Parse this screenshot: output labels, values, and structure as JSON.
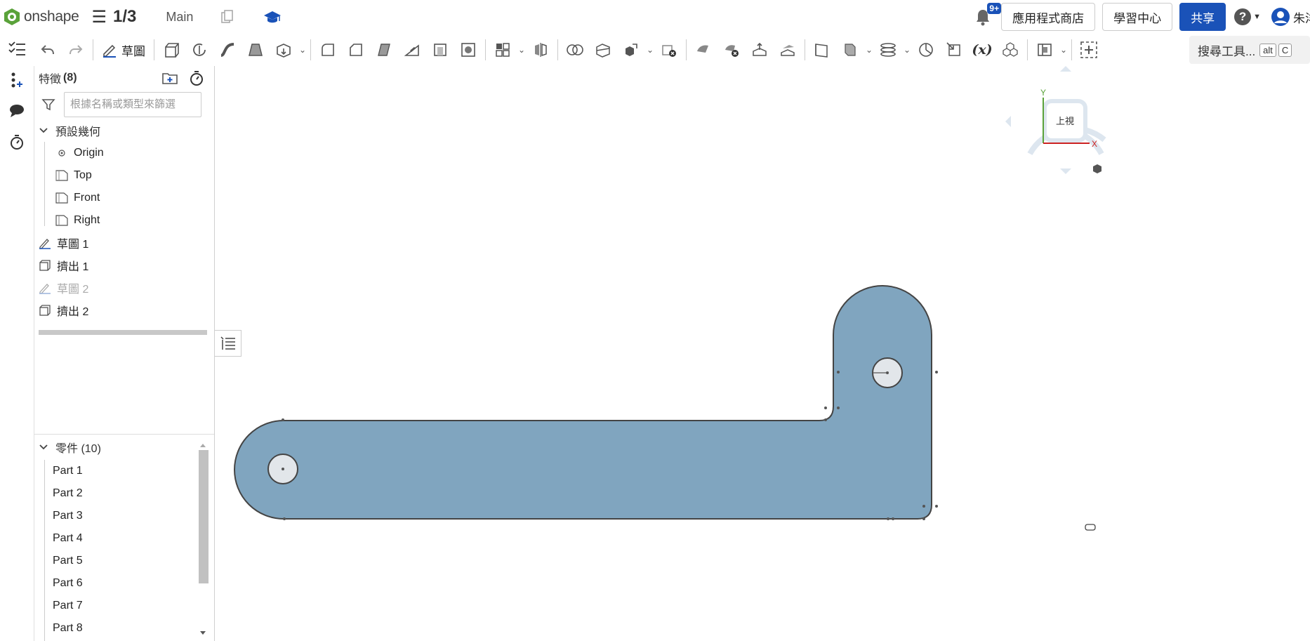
{
  "app": {
    "logo_text": "onshape",
    "doc_title": "1/3",
    "branch": "Main"
  },
  "header_right": {
    "notifications_badge": "9+",
    "app_store_label": "應用程式商店",
    "learning_center_label": "學習中心",
    "share_label": "共享",
    "user_name": "朱洋"
  },
  "toolbar": {
    "sketch_label": "草圖",
    "search_label": "搜尋工具...",
    "shortcut_alt": "alt",
    "shortcut_key": "C"
  },
  "features": {
    "header_label": "特徵",
    "count": "(8)",
    "filter_placeholder": "根據名稱或類型來篩選",
    "default_geometry_label": "預設幾何",
    "default_items": [
      {
        "label": "Origin"
      },
      {
        "label": "Top"
      },
      {
        "label": "Front"
      },
      {
        "label": "Right"
      }
    ],
    "items": [
      {
        "label": "草圖 1"
      },
      {
        "label": "擠出 1"
      },
      {
        "label": "草圖 2"
      },
      {
        "label": "擠出 2"
      }
    ]
  },
  "parts": {
    "header_label": "零件 (10)",
    "items": [
      {
        "label": "Part 1"
      },
      {
        "label": "Part 2"
      },
      {
        "label": "Part 3"
      },
      {
        "label": "Part 4"
      },
      {
        "label": "Part 5"
      },
      {
        "label": "Part 6"
      },
      {
        "label": "Part 7"
      },
      {
        "label": "Part 8"
      }
    ]
  },
  "viewcube": {
    "face_label": "上視",
    "axis_x": "X",
    "axis_y": "Y"
  },
  "colors": {
    "accent": "#1a52b8",
    "part_fill": "#80a5bf",
    "part_edge": "#444444"
  }
}
